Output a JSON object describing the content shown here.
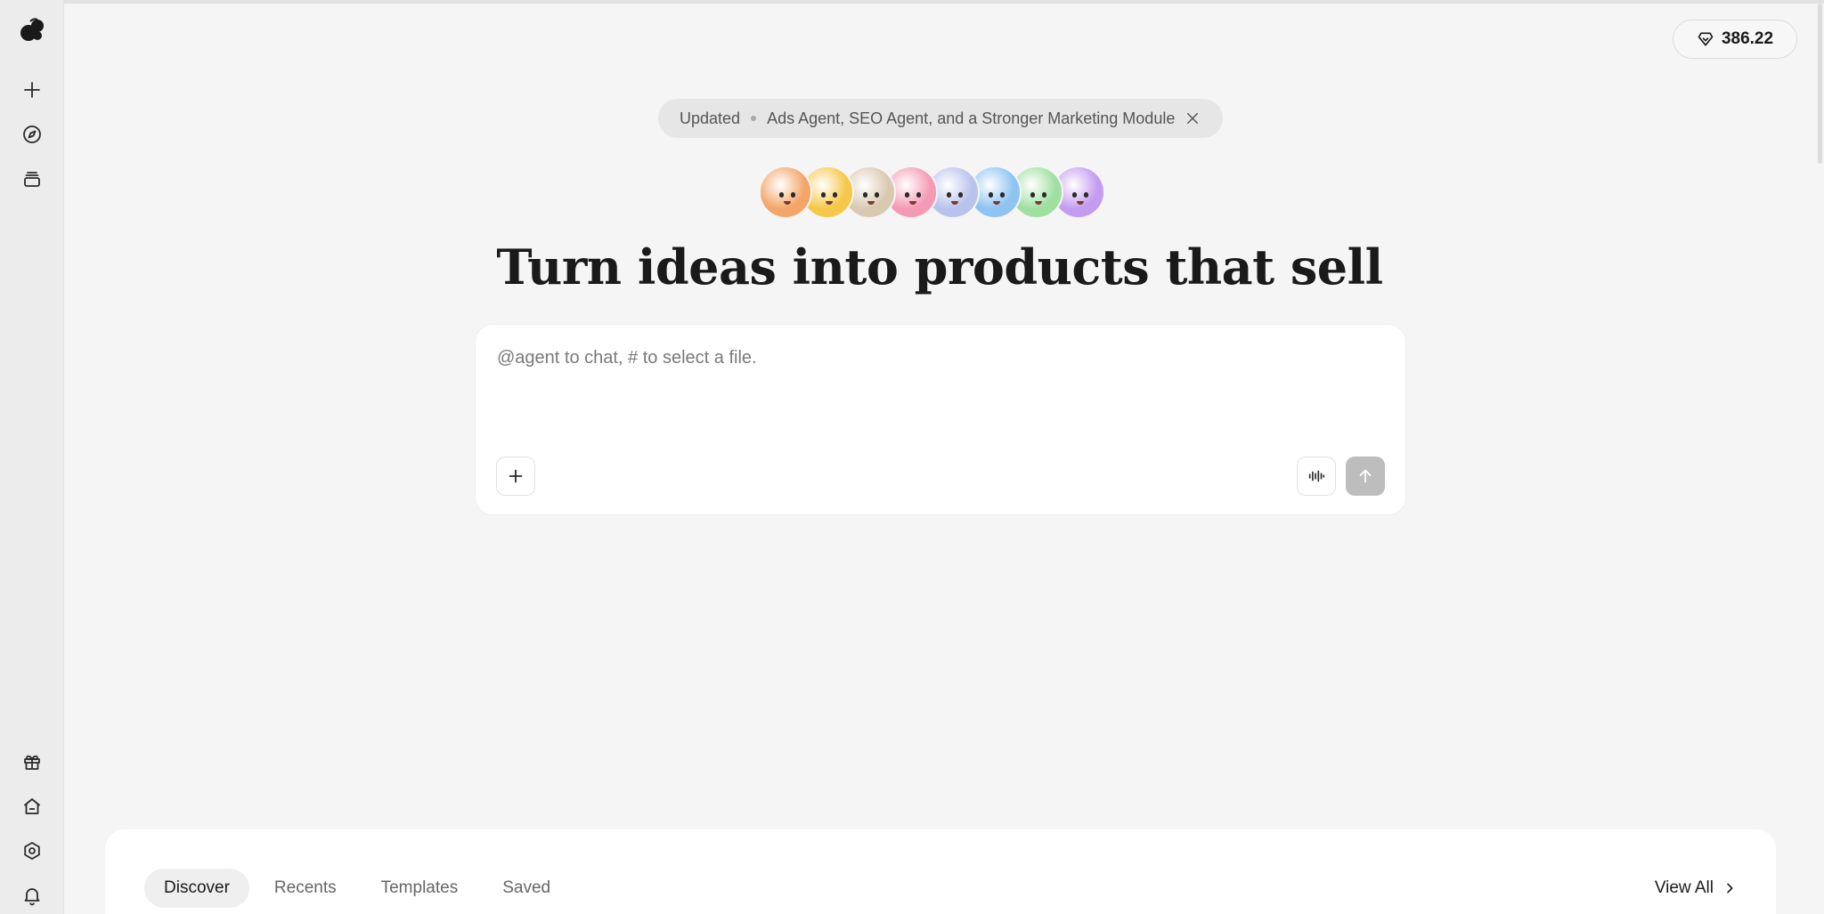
{
  "credits": {
    "value": "386.22",
    "icon": "diamond-icon"
  },
  "update_banner": {
    "label": "Updated",
    "message": "Ads Agent, SEO Agent, and a Stronger Marketing Module",
    "close_icon": "close-icon"
  },
  "agents": [
    {
      "name": "agent-avatar-1",
      "color": "#f4a66a"
    },
    {
      "name": "agent-avatar-2",
      "color": "#f6c84a"
    },
    {
      "name": "agent-avatar-3",
      "color": "#d9c9b0"
    },
    {
      "name": "agent-avatar-4",
      "color": "#f49ab4"
    },
    {
      "name": "agent-avatar-5",
      "color": "#b9c2ec"
    },
    {
      "name": "agent-avatar-6",
      "color": "#8ec3f2"
    },
    {
      "name": "agent-avatar-7",
      "color": "#9fe0a0"
    },
    {
      "name": "agent-avatar-8",
      "color": "#c49cf0"
    }
  ],
  "hero": {
    "title": "Turn ideas into products that sell"
  },
  "composer": {
    "placeholder": "@agent to chat, # to select a file.",
    "value": ""
  },
  "sidebar": {
    "top": [
      "logo-icon",
      "plus-icon",
      "compass-icon",
      "stack-icon"
    ],
    "bottom": [
      "gift-icon",
      "home-icon",
      "settings-icon",
      "bell-icon"
    ]
  },
  "panel": {
    "tabs": [
      "Discover",
      "Recents",
      "Templates",
      "Saved"
    ],
    "active_tab": "Discover",
    "view_all": "View All"
  },
  "colors": {
    "background": "#f5f5f5",
    "sidebar": "#ececec",
    "send_disabled": "#bdbdbd"
  }
}
